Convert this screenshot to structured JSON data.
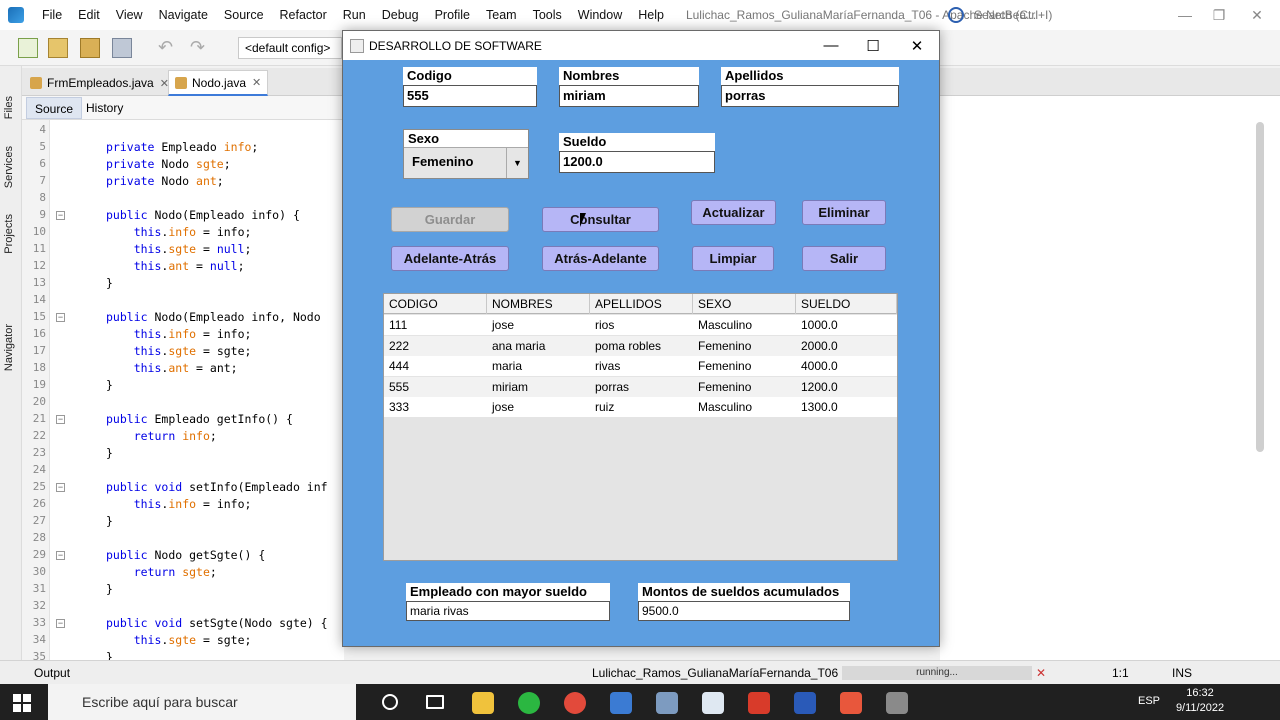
{
  "ide": {
    "menus": [
      "File",
      "Edit",
      "View",
      "Navigate",
      "Source",
      "Refactor",
      "Run",
      "Debug",
      "Profile",
      "Team",
      "Tools",
      "Window",
      "Help"
    ],
    "window_title": "Lulichac_Ramos_GulianaMaríaFernanda_T06 - Apache NetBea...",
    "search_placeholder": "Search (Ctrl+I)",
    "config": "<default config>",
    "side_labels": [
      "Files",
      "Services",
      "Projects",
      "Navigator"
    ],
    "tabs": [
      {
        "label": "FrmEmpleados.java"
      },
      {
        "label": "Nodo.java"
      }
    ],
    "editor_tabs": {
      "source": "Source",
      "history": "History"
    },
    "code_lines": [
      {
        "n": "4",
        "text": ""
      },
      {
        "n": "5",
        "text": "private Empleado info;"
      },
      {
        "n": "6",
        "text": "private Nodo sgte;"
      },
      {
        "n": "7",
        "text": "private Nodo ant;"
      },
      {
        "n": "8",
        "text": ""
      },
      {
        "n": "9",
        "text": "public Nodo(Empleado info) {"
      },
      {
        "n": "10",
        "text": "    this.info = info;"
      },
      {
        "n": "11",
        "text": "    this.sgte = null;"
      },
      {
        "n": "12",
        "text": "    this.ant = null;"
      },
      {
        "n": "13",
        "text": "}"
      },
      {
        "n": "14",
        "text": ""
      },
      {
        "n": "15",
        "text": "public Nodo(Empleado info, Nodo"
      },
      {
        "n": "16",
        "text": "    this.info = info;"
      },
      {
        "n": "17",
        "text": "    this.sgte = sgte;"
      },
      {
        "n": "18",
        "text": "    this.ant = ant;"
      },
      {
        "n": "19",
        "text": "}"
      },
      {
        "n": "20",
        "text": ""
      },
      {
        "n": "21",
        "text": "public Empleado getInfo() {"
      },
      {
        "n": "22",
        "text": "    return info;"
      },
      {
        "n": "23",
        "text": "}"
      },
      {
        "n": "24",
        "text": ""
      },
      {
        "n": "25",
        "text": "public void setInfo(Empleado inf"
      },
      {
        "n": "26",
        "text": "    this.info = info;"
      },
      {
        "n": "27",
        "text": "}"
      },
      {
        "n": "28",
        "text": ""
      },
      {
        "n": "29",
        "text": "public Nodo getSgte() {"
      },
      {
        "n": "30",
        "text": "    return sgte;"
      },
      {
        "n": "31",
        "text": "}"
      },
      {
        "n": "32",
        "text": ""
      },
      {
        "n": "33",
        "text": "public void setSgte(Nodo sgte) {"
      },
      {
        "n": "34",
        "text": "    this.sgte = sgte;"
      },
      {
        "n": "35",
        "text": "}"
      }
    ],
    "status": {
      "output": "Output",
      "run_label": "Lulichac_Ramos_GulianaMaríaFernanda_T06 (run)",
      "progress": "running...",
      "position": "1:1",
      "mode": "INS"
    }
  },
  "app": {
    "title": "DESARROLLO DE SOFTWARE",
    "fields": {
      "codigo": {
        "label": "Codigo",
        "value": "555"
      },
      "nombres": {
        "label": "Nombres",
        "value": "miriam"
      },
      "apellidos": {
        "label": "Apellidos",
        "value": "porras"
      },
      "sexo": {
        "label": "Sexo",
        "value": "Femenino"
      },
      "sueldo": {
        "label": "Sueldo",
        "value": "1200.0"
      }
    },
    "buttons": {
      "guardar": "Guardar",
      "consultar": "Consultar",
      "actualizar": "Actualizar",
      "eliminar": "Eliminar",
      "adelante_atras": "Adelante-Atrás",
      "atras_adelante": "Atrás-Adelante",
      "limpiar": "Limpiar",
      "salir": "Salir"
    },
    "table": {
      "columns": [
        "CODIGO",
        "NOMBRES",
        "APELLIDOS",
        "SEXO",
        "SUELDO"
      ],
      "rows": [
        [
          "111",
          "jose",
          "rios",
          "Masculino",
          "1000.0"
        ],
        [
          "222",
          "ana maria",
          "poma robles",
          "Femenino",
          "2000.0"
        ],
        [
          "444",
          "maria",
          "rivas",
          "Femenino",
          "4000.0"
        ],
        [
          "555",
          "miriam",
          "porras",
          "Femenino",
          "1200.0"
        ],
        [
          "333",
          "jose",
          "ruiz",
          "Masculino",
          "1300.0"
        ]
      ]
    },
    "summary": {
      "mayor_label": "Empleado con mayor sueldo",
      "mayor_value": "maria rivas",
      "montos_label": "Montos de sueldos acumulados",
      "montos_value": "9500.0"
    }
  },
  "taskbar": {
    "search_placeholder": "Escribe aquí para buscar",
    "lang": "ESP",
    "time": "16:32",
    "date": "9/11/2022"
  }
}
